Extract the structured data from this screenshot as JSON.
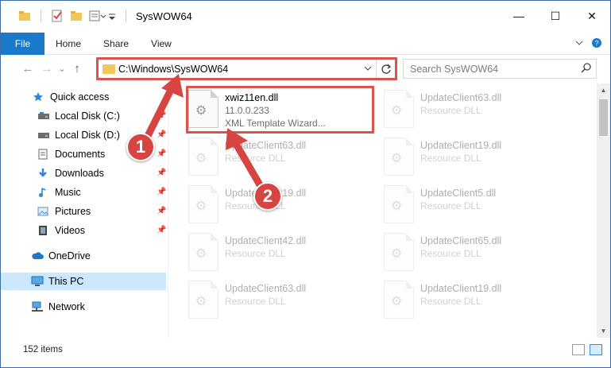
{
  "window": {
    "title": "SysWOW64",
    "controls": {
      "minimize": "—",
      "maximize": "☐",
      "close": "✕"
    }
  },
  "ribbon": {
    "tabs": [
      "File",
      "Home",
      "Share",
      "View"
    ],
    "expand_icon": "chevron-down-icon",
    "help_icon": "help-icon"
  },
  "nav": {
    "back": "←",
    "forward": "→",
    "recent": "⌄",
    "up": "↑",
    "address": "C:\\Windows\\SysWOW64",
    "search_placeholder": "Search SysWOW64"
  },
  "sidebar": {
    "items": [
      {
        "label": "Quick access",
        "icon": "star-icon",
        "pinned": false
      },
      {
        "label": "Local Disk (C:)",
        "icon": "drive-icon",
        "pinned": true
      },
      {
        "label": "Local Disk (D:)",
        "icon": "drive-icon",
        "pinned": true
      },
      {
        "label": "Documents",
        "icon": "documents-icon",
        "pinned": true
      },
      {
        "label": "Downloads",
        "icon": "downloads-icon",
        "pinned": true
      },
      {
        "label": "Music",
        "icon": "music-icon",
        "pinned": true
      },
      {
        "label": "Pictures",
        "icon": "pictures-icon",
        "pinned": true
      },
      {
        "label": "Videos",
        "icon": "videos-icon",
        "pinned": true
      },
      {
        "label": "OneDrive",
        "icon": "cloud-icon",
        "pinned": false
      },
      {
        "label": "This PC",
        "icon": "computer-icon",
        "pinned": false,
        "selected": true
      },
      {
        "label": "Network",
        "icon": "network-icon",
        "pinned": false
      }
    ]
  },
  "files": [
    {
      "name": "xwiz11en.dll",
      "line2": "11.0.0.233",
      "line3": "XML Template Wizard...",
      "faded": false
    },
    {
      "name": "UpdateClient63.dll",
      "line2": "Resource DLL",
      "faded": true
    },
    {
      "name": "UpdateClient63.dll",
      "line2": "Resource DLL",
      "faded": true
    },
    {
      "name": "UpdateClient19.dll",
      "line2": "Resource DLL",
      "faded": true
    },
    {
      "name": "UpdateClient19.dll",
      "line2": "Resource DLL",
      "faded": true
    },
    {
      "name": "UpdateClient5.dll",
      "line2": "Resource DLL",
      "faded": true
    },
    {
      "name": "UpdateClient42.dll",
      "line2": "Resource DLL",
      "faded": true
    },
    {
      "name": "UpdateClient65.dll",
      "line2": "Resource DLL",
      "faded": true
    },
    {
      "name": "UpdateClient63.dll",
      "line2": "Resource DLL",
      "faded": true
    },
    {
      "name": "UpdateClient19.dll",
      "line2": "Resource DLL",
      "faded": true
    }
  ],
  "status": {
    "count": "152 items"
  },
  "annotations": {
    "badge1": "1",
    "badge2": "2",
    "color": "#d64541"
  }
}
